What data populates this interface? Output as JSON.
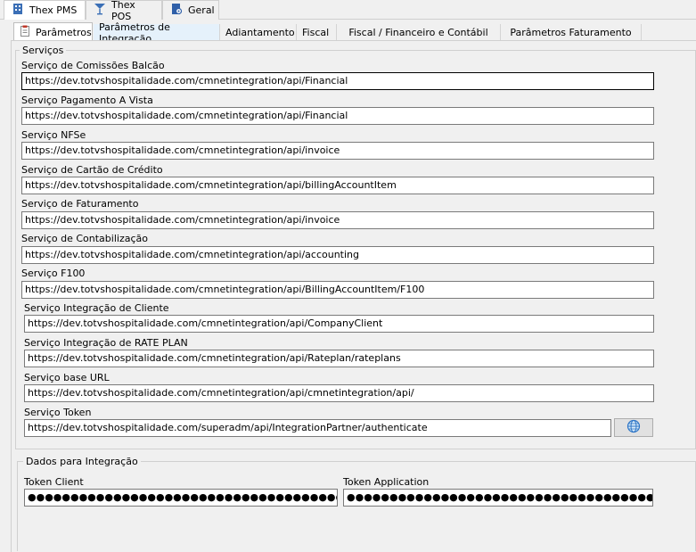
{
  "top_tabs": [
    {
      "label": "Thex PMS",
      "icon": "building-icon"
    },
    {
      "label": "Thex POS",
      "icon": "cocktail-icon"
    },
    {
      "label": "Geral",
      "icon": "settings-document-icon"
    }
  ],
  "sub_tabs": [
    {
      "label": "Parâmetros",
      "icon": "clipboard-icon"
    },
    {
      "label": "Parâmetros de Integração"
    },
    {
      "label": "Adiantamento"
    },
    {
      "label": "Fiscal"
    },
    {
      "label": "Fiscal / Financeiro e Contábil"
    },
    {
      "label": "Parâmetros Faturamento"
    }
  ],
  "services": {
    "title": "Serviços",
    "fields": [
      {
        "label": "Serviço de Comissões Balcão",
        "value": "https://dev.totvshospitalidade.com/cmnetintegration/api/Financial"
      },
      {
        "label": "Serviço Pagamento A Vista",
        "value": "https://dev.totvshospitalidade.com/cmnetintegration/api/Financial"
      },
      {
        "label": "Serviço NFSe",
        "value": "https://dev.totvshospitalidade.com/cmnetintegration/api/invoice"
      },
      {
        "label": "Serviço de Cartão de Crédito",
        "value": "https://dev.totvshospitalidade.com/cmnetintegration/api/billingAccountItem"
      },
      {
        "label": "Serviço de Faturamento",
        "value": "https://dev.totvshospitalidade.com/cmnetintegration/api/invoice"
      },
      {
        "label": "Serviço de Contabilização",
        "value": "https://dev.totvshospitalidade.com/cmnetintegration/api/accounting"
      },
      {
        "label": "Serviço F100",
        "value": "https://dev.totvshospitalidade.com/cmnetintegration/api/BillingAccountItem/F100"
      },
      {
        "label": "Serviço Integração de Cliente",
        "value": "https://dev.totvshospitalidade.com/cmnetintegration/api/CompanyClient"
      },
      {
        "label": "Serviço Integração de RATE PLAN",
        "value": "https://dev.totvshospitalidade.com/cmnetintegration/api/Rateplan/rateplans"
      },
      {
        "label": "Serviço base URL",
        "value": "https://dev.totvshospitalidade.com/cmnetintegration/api/cmnetintegration/api/"
      },
      {
        "label": "Serviço Token",
        "value": "https://dev.totvshospitalidade.com/superadm/api/IntegrationPartner/authenticate"
      }
    ]
  },
  "integration": {
    "title": "Dados para Integração",
    "token_client_label": "Token Client",
    "token_client_value": "●●●●●●●●●●●●●●●●●●●●●●●●●●●●●●●●●●●●●●●●●●●●●●●●●●●●●●●●●●●●",
    "token_application_label": "Token Application",
    "token_application_value": "●●●●●●●●●●●●●●●●●●●●●●●●●●●●●●●●●●●●●●●●●●●●●●●●●●●●●●●●●●●●●●"
  },
  "globe_button_icon": "globe-icon"
}
